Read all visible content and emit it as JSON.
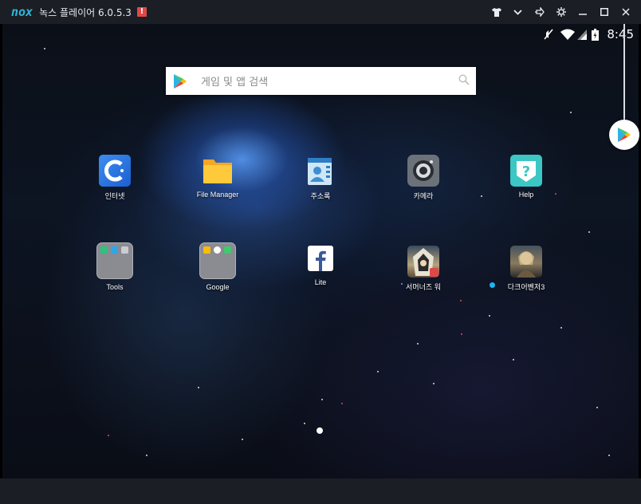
{
  "titlebar": {
    "logo": "nox",
    "title": "녹스 플레이어 6.0.5.3",
    "badge": "!",
    "buttons": [
      {
        "name": "tshirt-icon",
        "glyph": "👕"
      },
      {
        "name": "chevron-down-icon",
        "glyph": "⌄"
      },
      {
        "name": "pin-icon",
        "glyph": "⊳"
      },
      {
        "name": "gear-icon",
        "glyph": "⚙"
      },
      {
        "name": "minimize-icon",
        "glyph": "—"
      },
      {
        "name": "maximize-icon",
        "glyph": "☐"
      },
      {
        "name": "close-icon",
        "glyph": "✕"
      }
    ]
  },
  "statusbar": {
    "mute": "✕",
    "wifi": "◠",
    "signal": "◢",
    "battery": "▮",
    "time": "8:45"
  },
  "search": {
    "placeholder": "게임 및 앱 검색"
  },
  "apps": {
    "row1": [
      {
        "label": "인터넷",
        "icon": "browser-icon"
      },
      {
        "label": "File Manager",
        "icon": "file-manager-icon"
      },
      {
        "label": "주소록",
        "icon": "contacts-icon"
      },
      {
        "label": "카메라",
        "icon": "camera-icon"
      },
      {
        "label": "Help",
        "icon": "help-icon"
      }
    ],
    "row2": [
      {
        "label": "Tools",
        "icon": "tools-folder-icon"
      },
      {
        "label": "Google",
        "icon": "google-folder-icon"
      },
      {
        "label": "Lite",
        "icon": "facebook-lite-icon"
      },
      {
        "label": "서머너즈 워",
        "icon": "summoners-war-icon"
      },
      {
        "label": "다크어벤저3",
        "icon": "dark-avenger-3-icon"
      }
    ]
  },
  "colors": {
    "titlebar_bg": "#1b1e25",
    "accent": "#2fb6d8",
    "badge": "#e04848",
    "new_dot": "#1fb4f0"
  }
}
